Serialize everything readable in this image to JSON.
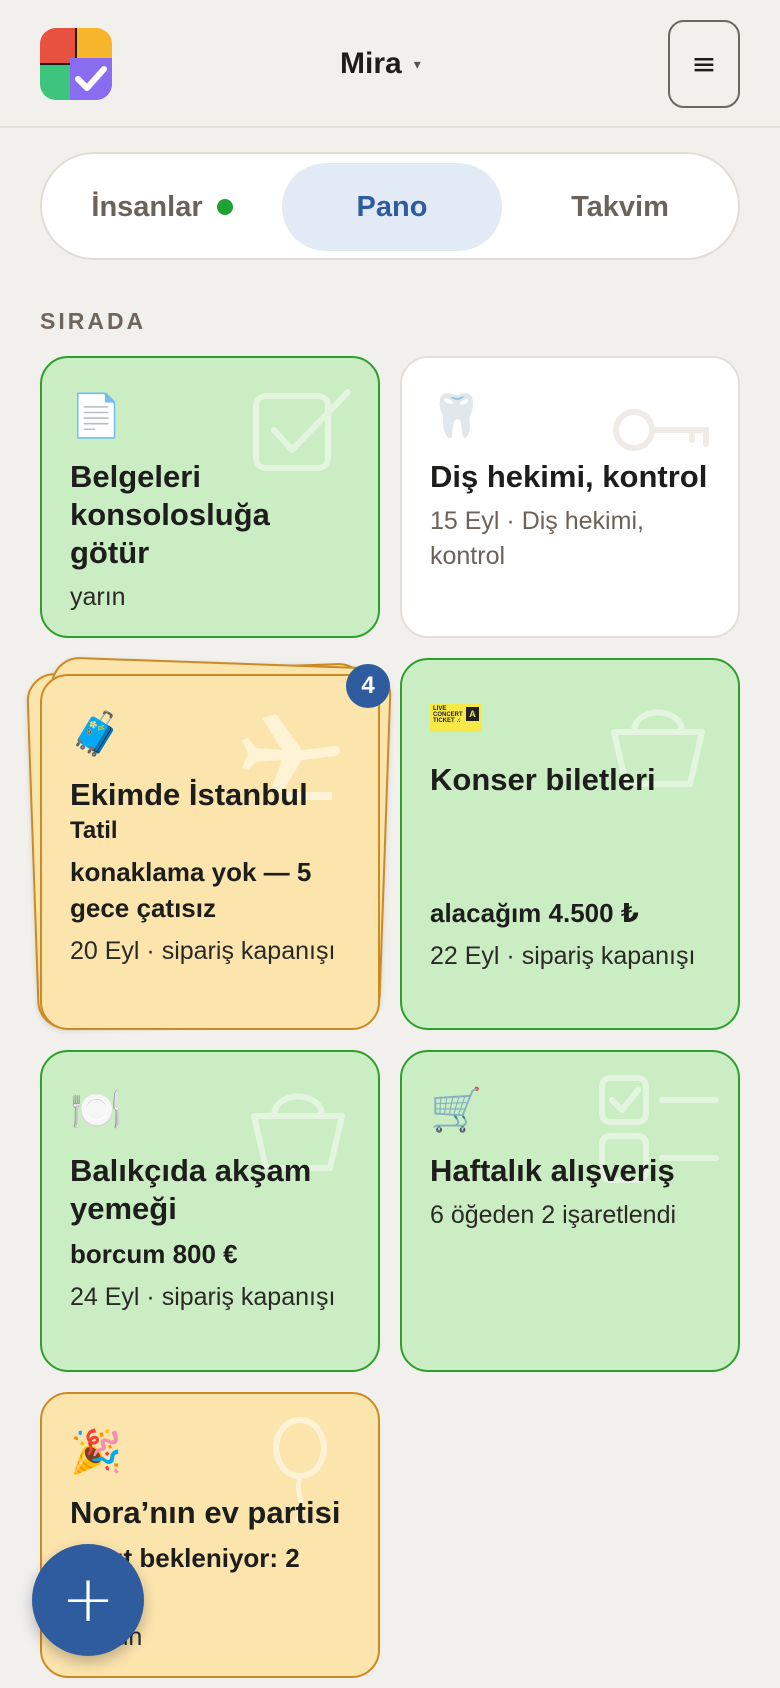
{
  "header": {
    "user_name": "Mira",
    "caret": "▾",
    "menu_glyph": "≡"
  },
  "tabs": [
    {
      "label": "İnsanlar",
      "online_dot": true
    },
    {
      "label": "Pano",
      "active": true
    },
    {
      "label": "Takvim"
    }
  ],
  "section": {
    "title": "SIRADA"
  },
  "cards": [
    {
      "emoji": "📄",
      "title": "Belgeleri konsolosluğa götür",
      "meta": "yarın",
      "color": "#cbedc3",
      "bg_icon": "checkbox-icon"
    },
    {
      "emoji": "🦷",
      "title": "Diş hekimi, kontrol",
      "meta": "15 Eyl · Diş hekimi, kontrol",
      "color": "#ffffff",
      "bg_icon": "key-icon"
    },
    {
      "emoji": "🧳",
      "title": "Ekimde İstanbul",
      "subtitle": "Tatil",
      "strong": "konaklama yok — 5 gece çatısız",
      "meta": "20 Eyl · sipariş kapanışı",
      "color": "#fce4ad",
      "bg_icon": "airplane-icon",
      "stack_count": "4"
    },
    {
      "ticket": {
        "line1": "LIVE",
        "line2": "CONCERT",
        "line3": "TICKET ♫",
        "seat": "A"
      },
      "title": "Konser biletleri",
      "strong": "alacağım 4.500 ₺",
      "meta": "22 Eyl · sipariş kapanışı",
      "color": "#cbedc3",
      "bg_icon": "basket-icon"
    },
    {
      "emoji": "🍽️",
      "title": "Balıkçıda akşam yemeği",
      "strong": "borcum 800 €",
      "meta": "24 Eyl · sipariş kapanışı",
      "color": "#cbedc3",
      "bg_icon": "basket-icon"
    },
    {
      "emoji": "🛒",
      "title": "Haftalık alışveriş",
      "meta": "6 öğeden 2 işaretlendi",
      "color": "#cbedc3",
      "bg_icon": "checklist-icon"
    },
    {
      "emoji": "🎉",
      "title": "Nora’nın ev partisi",
      "strong": "Yanıt bekleniyor: 2 kişi",
      "meta": "Bugün",
      "color": "#fce4ad",
      "bg_icon": "balloon-icon"
    }
  ],
  "fab": {
    "label": "+"
  }
}
